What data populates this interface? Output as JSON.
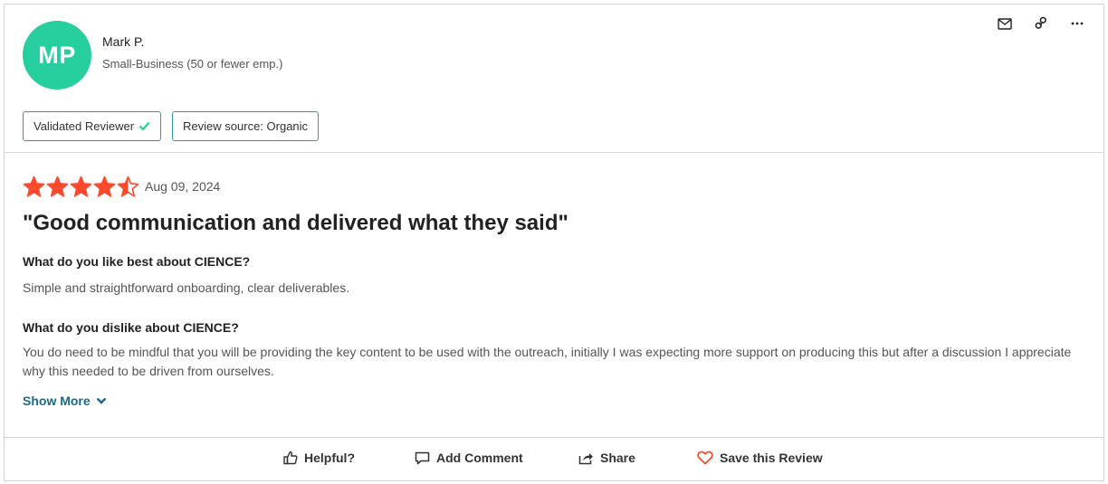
{
  "reviewer": {
    "initials": "MP",
    "name": "Mark P.",
    "segment": "Small-Business (50 or fewer emp.)",
    "avatar_color": "#27cf9f"
  },
  "top_actions": {
    "icons": [
      "mail-icon",
      "link-icon",
      "more-icon"
    ]
  },
  "badges": {
    "validated": "Validated Reviewer",
    "source": "Review source: Organic"
  },
  "review": {
    "rating": 4.5,
    "rating_max": 5,
    "star_color": "#ff492c",
    "date": "Aug 09, 2024",
    "title": "\"Good communication and delivered what they said\"",
    "questions": [
      {
        "q": "What do you like best about CIENCE?",
        "a": "Simple and straightforward onboarding, clear deliverables."
      },
      {
        "q": "What do you dislike about CIENCE?",
        "a": "You do need to be mindful that you will be providing the key content to be used with the outreach, initially I was expecting more support on producing this but after a discussion I appreciate why this needed to be driven from ourselves."
      }
    ],
    "show_more": "Show More"
  },
  "footer": {
    "helpful": "Helpful?",
    "add_comment": "Add Comment",
    "share": "Share",
    "save": "Save this Review"
  },
  "colors": {
    "badge_border": "#2aa0a0",
    "link": "#1a6a8a",
    "save_heart": "#ff492c"
  }
}
